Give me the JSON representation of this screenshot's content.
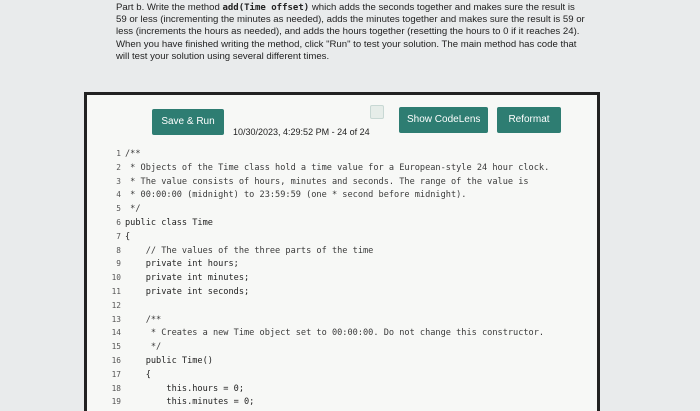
{
  "instructions": {
    "prefix": "Part b. Write the method ",
    "method_sig": "add(Time offset)",
    "rest": " which adds the seconds together and makes sure the result is 59 or less (incrementing the minutes as needed), adds the minutes together and makes sure the result is 59 or less (increments the hours as needed), and adds the hours together (resetting the hours to 0 if it reaches 24). When you have finished writing the method, click \"Run\" to test your solution. The main method has code that will test your solution using several different times."
  },
  "toolbar": {
    "save_run_label": "Save & Run",
    "codelens_label": "Show CodeLens",
    "reformat_label": "Reformat",
    "timestamp": "10/30/2023, 4:29:52 PM - 24 of 24"
  },
  "code_lines": [
    {
      "n": "1",
      "text": "/**"
    },
    {
      "n": "2",
      "text": " * Objects of the Time class hold a time value for a European-style 24 hour clock."
    },
    {
      "n": "3",
      "text": " * The value consists of hours, minutes and seconds. The range of the value is"
    },
    {
      "n": "4",
      "text": " * 00:00:00 (midnight) to 23:59:59 (one * second before midnight)."
    },
    {
      "n": "5",
      "text": " */"
    },
    {
      "n": "6",
      "text": "public class Time"
    },
    {
      "n": "7",
      "text": "{"
    },
    {
      "n": "8",
      "text": "    // The values of the three parts of the time"
    },
    {
      "n": "9",
      "text": "    private int hours;"
    },
    {
      "n": "10",
      "text": "    private int minutes;"
    },
    {
      "n": "11",
      "text": "    private int seconds;"
    },
    {
      "n": "12",
      "text": ""
    },
    {
      "n": "13",
      "text": "    /**"
    },
    {
      "n": "14",
      "text": "     * Creates a new Time object set to 00:00:00. Do not change this constructor."
    },
    {
      "n": "15",
      "text": "     */"
    },
    {
      "n": "16",
      "text": "    public Time()"
    },
    {
      "n": "17",
      "text": "    {"
    },
    {
      "n": "18",
      "text": "        this.hours = 0;"
    },
    {
      "n": "19",
      "text": "        this.minutes = 0;"
    }
  ]
}
